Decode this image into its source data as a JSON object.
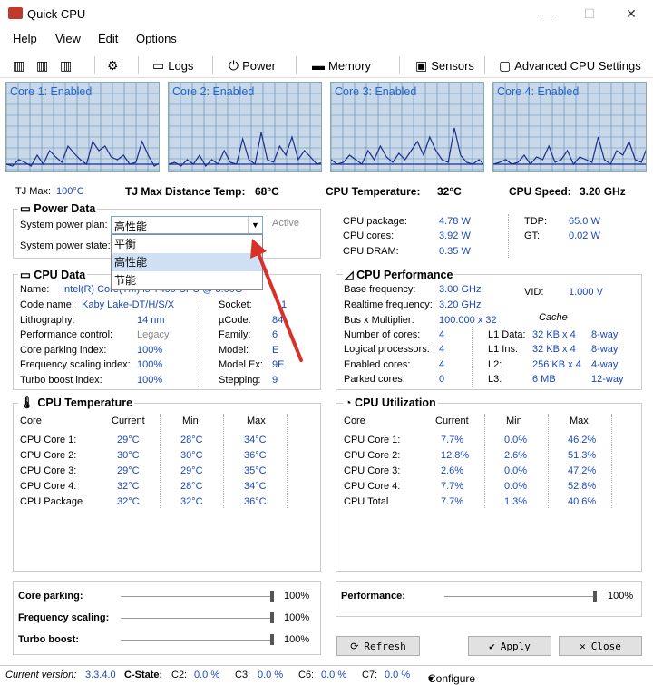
{
  "window": {
    "title": "Quick CPU"
  },
  "menu": [
    "Help",
    "View",
    "Edit",
    "Options"
  ],
  "toolbar": {
    "logs": "Logs",
    "power": "Power",
    "memory": "Memory",
    "sensors": "Sensors",
    "advanced": "Advanced CPU Settings"
  },
  "graphs": [
    {
      "label": "Core 1: Enabled",
      "values": [
        0.1,
        0.08,
        0.15,
        0.12,
        0.08,
        0.2,
        0.1,
        0.25,
        0.18,
        0.12,
        0.3,
        0.22,
        0.15,
        0.1,
        0.35,
        0.25,
        0.3,
        0.18,
        0.15,
        0.2,
        0.1,
        0.12,
        0.35,
        0.2,
        0.08,
        0.12
      ]
    },
    {
      "label": "Core 2: Enabled",
      "values": [
        0.1,
        0.12,
        0.08,
        0.15,
        0.1,
        0.2,
        0.08,
        0.15,
        0.1,
        0.25,
        0.12,
        0.1,
        0.38,
        0.15,
        0.1,
        0.45,
        0.15,
        0.12,
        0.3,
        0.2,
        0.4,
        0.15,
        0.25,
        0.18,
        0.1,
        0.12
      ]
    },
    {
      "label": "Core 3: Enabled",
      "values": [
        0.15,
        0.1,
        0.12,
        0.2,
        0.15,
        0.1,
        0.25,
        0.15,
        0.3,
        0.18,
        0.12,
        0.22,
        0.15,
        0.25,
        0.35,
        0.2,
        0.4,
        0.25,
        0.15,
        0.12,
        0.5,
        0.2,
        0.12,
        0.1,
        0.15,
        0.08
      ]
    },
    {
      "label": "Core 4: Enabled",
      "values": [
        0.1,
        0.12,
        0.15,
        0.1,
        0.12,
        0.2,
        0.1,
        0.18,
        0.15,
        0.3,
        0.12,
        0.15,
        0.25,
        0.1,
        0.18,
        0.15,
        0.12,
        0.4,
        0.15,
        0.1,
        0.25,
        0.2,
        0.35,
        0.15,
        0.12,
        0.3
      ]
    }
  ],
  "stats": {
    "tj_max_label": "TJ Max:",
    "tj_max_value": "100°C",
    "tj_dist_label": "TJ Max Distance Temp:",
    "tj_dist_value": "68°C",
    "cpu_temp_label": "CPU Temperature:",
    "cpu_temp_value": "32°C",
    "cpu_speed_label": "CPU Speed:",
    "cpu_speed_value": "3.20 GHz"
  },
  "power": {
    "title": "Power Data",
    "plan_label": "System power plan:",
    "plan_value": "高性能",
    "state_label": "System power state:",
    "active": "Active",
    "options": [
      "平衡",
      "高性能",
      "节能"
    ],
    "rows": [
      {
        "label": "CPU package:",
        "value": "4.78 W"
      },
      {
        "label": "CPU cores:",
        "value": "3.92 W"
      },
      {
        "label": "CPU DRAM:",
        "value": "0.35 W"
      }
    ],
    "tdp_label": "TDP:",
    "tdp_value": "65.0 W",
    "gt_label": "GT:",
    "gt_value": "0.02 W"
  },
  "cpu_data": {
    "title": "CPU Data",
    "name_label": "Name:",
    "name_value": "Intel(R) Core(TM) i5-7400 CPU @ 3.00GHz",
    "left": [
      {
        "label": "Code name:",
        "value": "Kaby Lake-DT/H/S/X"
      },
      {
        "label": "Lithography:",
        "value": "14 nm"
      },
      {
        "label": "Performance control:",
        "value": "Legacy"
      },
      {
        "label": "Core parking index:",
        "value": "100%"
      },
      {
        "label": "Frequency scaling index:",
        "value": "100%"
      },
      {
        "label": "Turbo boost index:",
        "value": "100%"
      }
    ],
    "right": [
      {
        "label": "Socket:",
        "value": "1"
      },
      {
        "label": "µCode:",
        "value": "84"
      },
      {
        "label": "Family:",
        "value": "6"
      },
      {
        "label": "Model:",
        "value": "E"
      },
      {
        "label": "Model Ex:",
        "value": "9E"
      },
      {
        "label": "Stepping:",
        "value": "9"
      }
    ]
  },
  "cpu_perf": {
    "title": "CPU Performance",
    "base_label": "Base frequency:",
    "base_value": "3.00 GHz",
    "rt_label": "Realtime frequency:",
    "rt_value": "3.20 GHz",
    "vid_label": "VID:",
    "vid_value": "1.000 V",
    "bus_label": "Bus x Multiplier:",
    "bus_value": "100.000 x 32",
    "cache_title": "Cache",
    "rows": [
      {
        "label": "Number of cores:",
        "value": "4",
        "cl": "L1 Data:",
        "cs": "32 KB x 4",
        "cw": "8-way"
      },
      {
        "label": "Logical processors:",
        "value": "4",
        "cl": "L1 Ins:",
        "cs": "32 KB x 4",
        "cw": "8-way"
      },
      {
        "label": "Enabled cores:",
        "value": "4",
        "cl": "L2:",
        "cs": "256 KB x 4",
        "cw": "4-way"
      },
      {
        "label": "Parked cores:",
        "value": "0",
        "cl": "L3:",
        "cs": "6 MB",
        "cw": "12-way"
      }
    ]
  },
  "cpu_temp": {
    "title": "CPU Temperature",
    "headers": [
      "Core",
      "Current",
      "Min",
      "Max"
    ],
    "rows": [
      [
        "CPU Core 1:",
        "29°C",
        "28°C",
        "34°C"
      ],
      [
        "CPU Core 2:",
        "30°C",
        "30°C",
        "36°C"
      ],
      [
        "CPU Core 3:",
        "29°C",
        "29°C",
        "35°C"
      ],
      [
        "CPU Core 4:",
        "32°C",
        "28°C",
        "34°C"
      ],
      [
        "CPU Package",
        "32°C",
        "32°C",
        "36°C"
      ]
    ]
  },
  "cpu_util": {
    "title": "CPU Utilization",
    "headers": [
      "Core",
      "Current",
      "Min",
      "Max"
    ],
    "rows": [
      [
        "CPU Core 1:",
        "7.7%",
        "0.0%",
        "46.2%"
      ],
      [
        "CPU Core 2:",
        "12.8%",
        "2.6%",
        "51.3%"
      ],
      [
        "CPU Core 3:",
        "2.6%",
        "0.0%",
        "47.2%"
      ],
      [
        "CPU Core 4:",
        "7.7%",
        "0.0%",
        "52.8%"
      ],
      [
        "CPU Total",
        "7.7%",
        "1.3%",
        "40.6%"
      ]
    ]
  },
  "sliders": {
    "core_parking": {
      "label": "Core parking:",
      "value": "100%"
    },
    "freq_scaling": {
      "label": "Frequency scaling:",
      "value": "100%"
    },
    "turbo_boost": {
      "label": "Turbo boost:",
      "value": "100%"
    },
    "performance": {
      "label": "Performance:",
      "value": "100%"
    }
  },
  "buttons": {
    "refresh": "Refresh",
    "apply": "Apply",
    "close": "Close"
  },
  "status": {
    "version_label": "Current version:",
    "version": "3.3.4.0",
    "cstate_label": "C-State:",
    "c2": "C2:",
    "c2v": "0.0 %",
    "c3": "C3:",
    "c3v": "0.0 %",
    "c6": "C6:",
    "c6v": "0.0 %",
    "c7": "C7:",
    "c7v": "0.0 %",
    "configure": "Configure"
  },
  "colors": {
    "graph_bg": "#c8d8e8",
    "graph_line": "#1a2e8a",
    "label_blue": "#1a47b8",
    "arrow_red": "#d9302a"
  }
}
